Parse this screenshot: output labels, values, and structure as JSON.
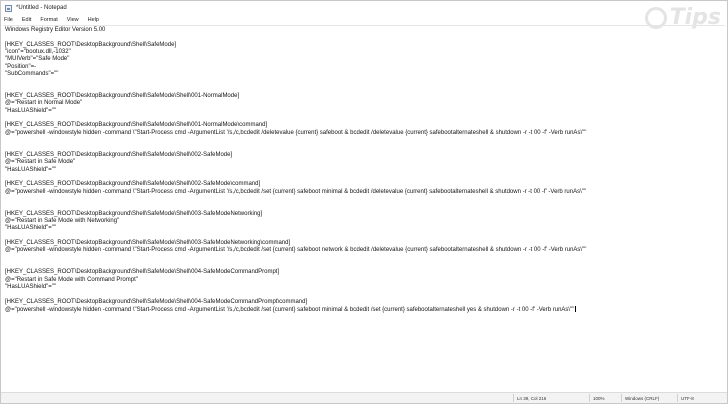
{
  "window": {
    "title": "*Untitled - Notepad"
  },
  "menu": [
    "File",
    "Edit",
    "Format",
    "View",
    "Help"
  ],
  "editor": {
    "lines": [
      "Windows Registry Editor Version 5.00",
      "",
      "[HKEY_CLASSES_ROOT\\DesktopBackground\\Shell\\SafeMode]",
      "\"icon\"=\"bootux.dll,-1032\"",
      "\"MUIVerb\"=\"Safe Mode\"",
      "\"Position\"=-",
      "\"SubCommands\"=\"\"",
      "",
      "",
      "[HKEY_CLASSES_ROOT\\DesktopBackground\\Shell\\SafeMode\\Shell\\001-NormalMode]",
      "@=\"Restart in Normal Mode\"",
      "\"HasLUAShield\"=\"\"",
      "",
      "[HKEY_CLASSES_ROOT\\DesktopBackground\\Shell\\SafeMode\\Shell\\001-NormalMode\\command]",
      "@=\"powershell -windowstyle hidden -command \\\"Start-Process cmd -ArgumentList '/s,/c,bcdedit /deletevalue {current} safeboot & bcdedit /deletevalue {current} safebootalternateshell & shutdown -r -t 00 -f' -Verb runAs\\\"\"",
      "",
      "",
      "[HKEY_CLASSES_ROOT\\DesktopBackground\\Shell\\SafeMode\\Shell\\002-SafeMode]",
      "@=\"Restart in Safe Mode\"",
      "\"HasLUAShield\"=\"\"",
      "",
      "[HKEY_CLASSES_ROOT\\DesktopBackground\\Shell\\SafeMode\\Shell\\002-SafeMode\\command]",
      "@=\"powershell -windowstyle hidden -command \\\"Start-Process cmd -ArgumentList '/s,/c,bcdedit /set {current} safeboot minimal & bcdedit /deletevalue {current} safebootalternateshell & shutdown -r -t 00 -f' -Verb runAs\\\"\"",
      "",
      "",
      "[HKEY_CLASSES_ROOT\\DesktopBackground\\Shell\\SafeMode\\Shell\\003-SafeModeNetworking]",
      "@=\"Restart in Safe Mode with Networking\"",
      "\"HasLUAShield\"=\"\"",
      "",
      "[HKEY_CLASSES_ROOT\\DesktopBackground\\Shell\\SafeMode\\Shell\\003-SafeModeNetworking\\command]",
      "@=\"powershell -windowstyle hidden -command \\\"Start-Process cmd -ArgumentList '/s,/c,bcdedit /set {current} safeboot network & bcdedit /deletevalue {current} safebootalternateshell & shutdown -r -t 00 -f' -Verb runAs\\\"\"",
      "",
      "",
      "[HKEY_CLASSES_ROOT\\DesktopBackground\\Shell\\SafeMode\\Shell\\004-SafeModeCommandPrompt]",
      "@=\"Restart in Safe Mode with Command Prompt\"",
      "\"HasLUAShield\"=\"\"",
      "",
      "[HKEY_CLASSES_ROOT\\DesktopBackground\\Shell\\SafeMode\\Shell\\004-SafeModeCommandPrompt\\command]",
      "@=\"powershell -windowstyle hidden -command \\\"Start-Process cmd -ArgumentList '/s,/c,bcdedit /set {current} safeboot minimal & bcdedit /set {current} safebootalternateshell yes & shutdown -r -t 00 -f' -Verb runAs\\\"\""
    ]
  },
  "status": {
    "position": "Ln 39, Col 216",
    "zoom": "100%",
    "line_ending": "Windows (CRLF)",
    "encoding": "UTF-8"
  },
  "watermark": {
    "text": "Tips",
    "color": "#e1e1e1"
  }
}
